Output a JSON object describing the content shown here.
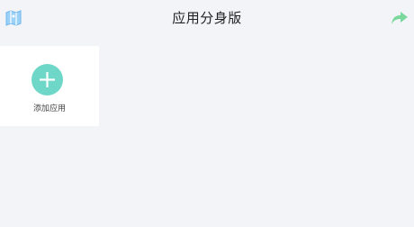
{
  "header": {
    "title": "应用分身版",
    "left_icon": "map-icon",
    "right_icon": "share-icon"
  },
  "apps": [
    {
      "label": "添加应用",
      "icon": "plus-icon"
    }
  ],
  "colors": {
    "background": "#f3f4f8",
    "tile": "#ffffff",
    "accent_teal": "#6fd7c8",
    "map_blue": "#8ec5f5",
    "share_green": "#76d79a"
  }
}
